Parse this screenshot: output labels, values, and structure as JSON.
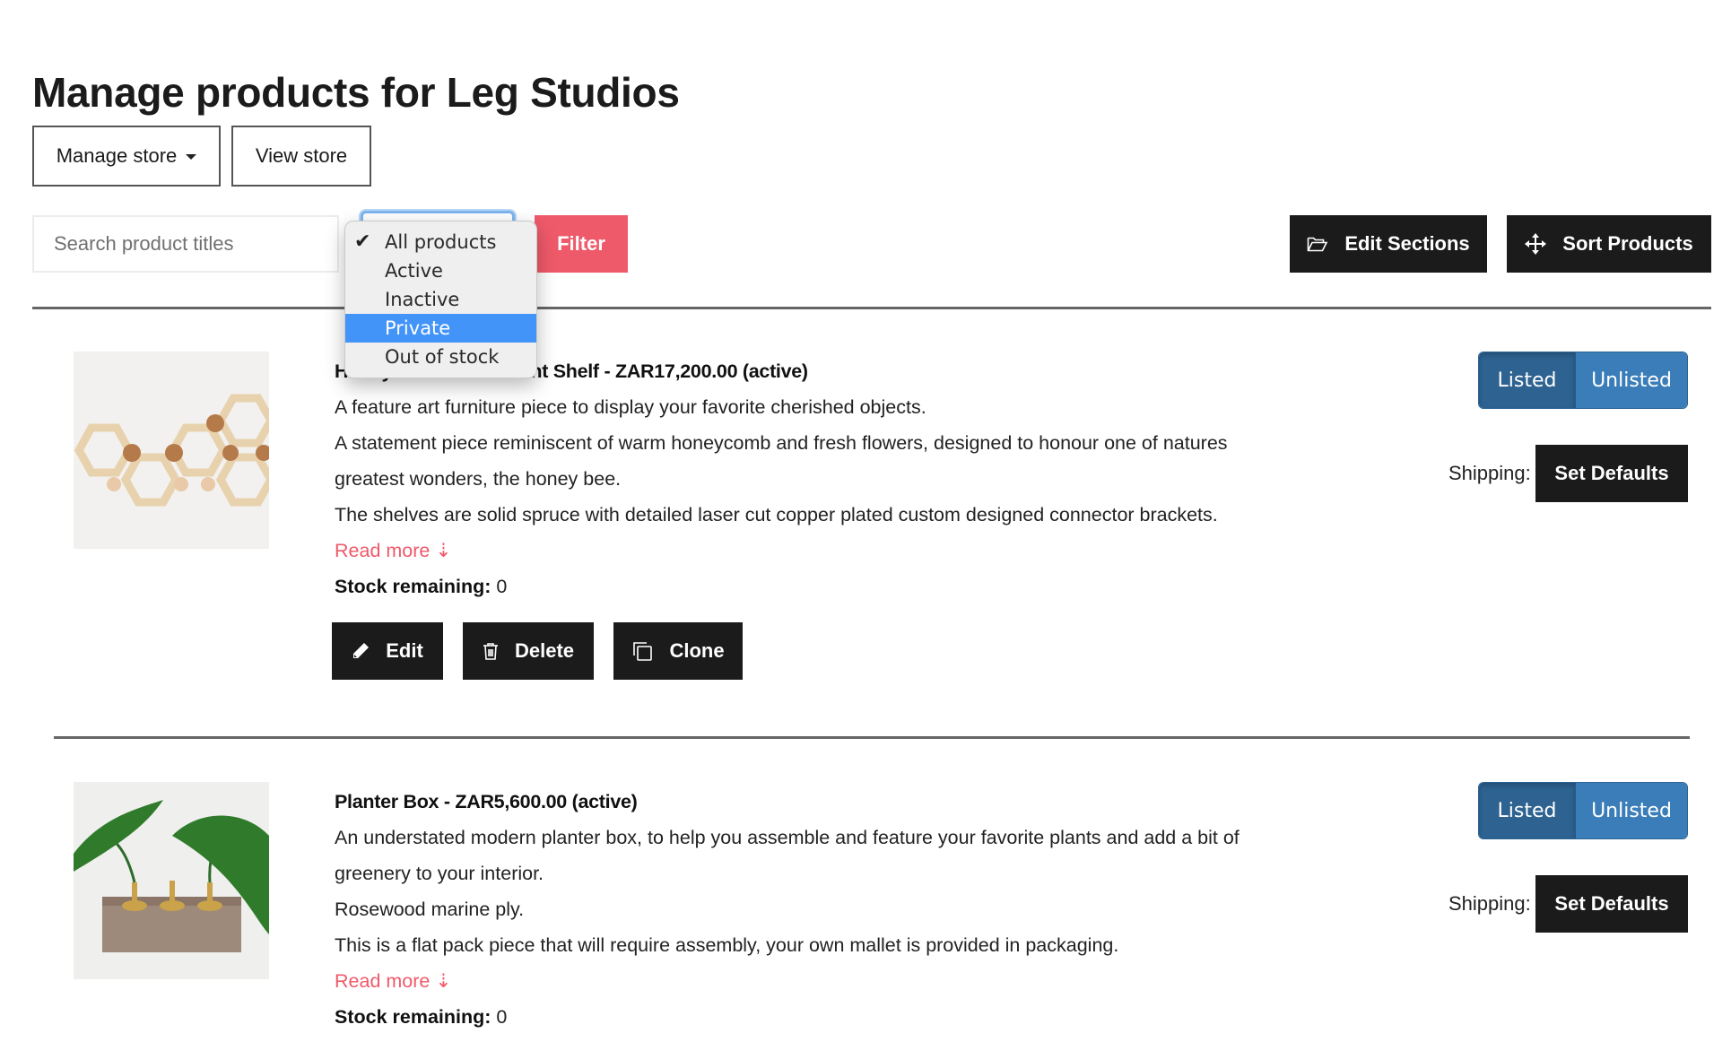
{
  "header": {
    "title": "Manage products for Leg Studios",
    "manage_store_label": "Manage store",
    "view_store_label": "View store"
  },
  "toolbar": {
    "search_placeholder": "Search product titles",
    "search_value": "",
    "filter_label": "Filter",
    "edit_sections_label": "Edit Sections",
    "sort_products_label": "Sort Products",
    "filter_select": {
      "selected": "All products",
      "highlighted": "Private",
      "options": [
        "All products",
        "Active",
        "Inactive",
        "Private",
        "Out of stock"
      ]
    }
  },
  "colors": {
    "accent": "#ef5a6a",
    "dark_button": "#1b1b1b",
    "listed_active": "#2d6291",
    "unlisted": "#3a7db8",
    "menu_highlight": "#4394f8"
  },
  "products": [
    {
      "title": "Honeycomb Wall-Mount Shelf - ZAR17,200.00 (active)",
      "description": [
        "A feature art furniture piece to display your favorite cherished objects.",
        "A statement piece reminiscent of warm honeycomb and fresh flowers, designed to honour one of natures",
        "greatest wonders, the honey bee.",
        "The shelves are solid spruce with detailed laser cut copper plated custom designed connector brackets."
      ],
      "read_more_label": "Read more ⇣",
      "stock_label": "Stock remaining:",
      "stock_value": "0",
      "actions": {
        "edit": "Edit",
        "delete": "Delete",
        "clone": "Clone"
      },
      "listing": {
        "listed": "Listed",
        "unlisted": "Unlisted",
        "state": "Listed"
      },
      "shipping_label": "Shipping:",
      "set_defaults_label": "Set Defaults",
      "image_alt": "Honeycomb shelf"
    },
    {
      "title": "Planter Box - ZAR5,600.00 (active)",
      "description": [
        "An understated modern planter box, to help you assemble and feature your favorite plants and add a bit of",
        "greenery to your interior.",
        "Rosewood marine ply.",
        "This is a flat pack piece that will require assembly, your own mallet is provided in packaging."
      ],
      "read_more_label": "Read more ⇣",
      "stock_label": "Stock remaining:",
      "stock_value": "0",
      "listing": {
        "listed": "Listed",
        "unlisted": "Unlisted",
        "state": "Listed"
      },
      "shipping_label": "Shipping:",
      "set_defaults_label": "Set Defaults",
      "image_alt": "Planter box"
    }
  ]
}
